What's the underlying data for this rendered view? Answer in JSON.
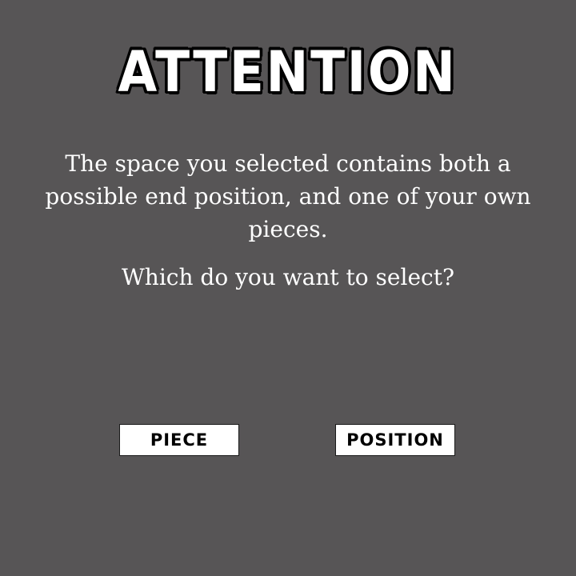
{
  "dialog": {
    "title": "ATTENTION",
    "message": "The space you selected contains both a possible end position, and one of your own pieces.",
    "question": "Which do you want to select?",
    "buttons": {
      "piece_label": "PIECE",
      "position_label": "POSITION"
    }
  },
  "colors": {
    "background": "#575556",
    "text": "#ffffff",
    "button_background": "#ffffff",
    "button_text": "#000000"
  }
}
